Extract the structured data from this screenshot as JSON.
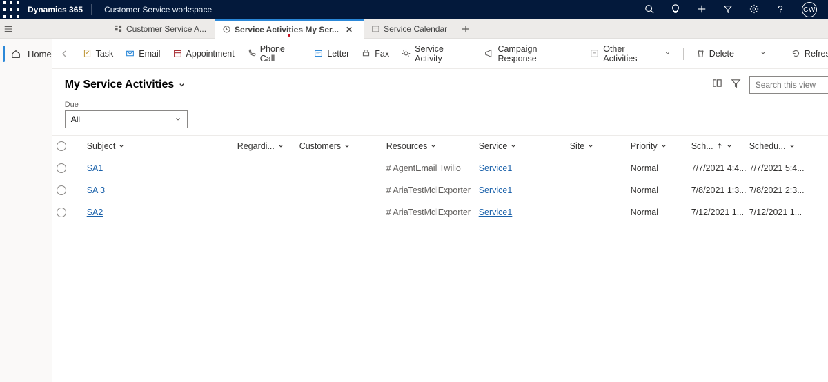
{
  "header": {
    "brand": "Dynamics 365",
    "workspace": "Customer Service workspace",
    "user_initials": "CW"
  },
  "tabs": [
    {
      "label": "Customer Service A...",
      "active": false
    },
    {
      "label": "Service Activities My Ser...",
      "active": true,
      "dirty": true
    },
    {
      "label": "Service Calendar",
      "active": false
    }
  ],
  "rail": {
    "home": "Home"
  },
  "commands": {
    "task": "Task",
    "email": "Email",
    "appointment": "Appointment",
    "phone": "Phone Call",
    "letter": "Letter",
    "fax": "Fax",
    "service_activity": "Service Activity",
    "campaign": "Campaign Response",
    "other": "Other Activities",
    "delete": "Delete",
    "refresh": "Refresh"
  },
  "view": {
    "title": "My Service Activities",
    "search_placeholder": "Search this view"
  },
  "filter": {
    "label": "Due",
    "value": "All"
  },
  "columns": {
    "subject": "Subject",
    "regarding": "Regardi...",
    "customers": "Customers",
    "resources": "Resources",
    "service": "Service",
    "site": "Site",
    "priority": "Priority",
    "scheduled_start": "Sch...",
    "scheduled_end": "Schedu..."
  },
  "rows": [
    {
      "subject": "SA1",
      "resources": "# AgentEmail Twilio",
      "service": "Service1",
      "priority": "Normal",
      "sch_start": "7/7/2021 4:4...",
      "sch_end": "7/7/2021 5:4..."
    },
    {
      "subject": "SA 3",
      "resources": "# AriaTestMdlExporter",
      "service": "Service1",
      "priority": "Normal",
      "sch_start": "7/8/2021 1:3...",
      "sch_end": "7/8/2021 2:3..."
    },
    {
      "subject": "SA2",
      "resources": "# AriaTestMdlExporter",
      "service": "Service1",
      "priority": "Normal",
      "sch_start": "7/12/2021 1...",
      "sch_end": "7/12/2021 1..."
    }
  ]
}
